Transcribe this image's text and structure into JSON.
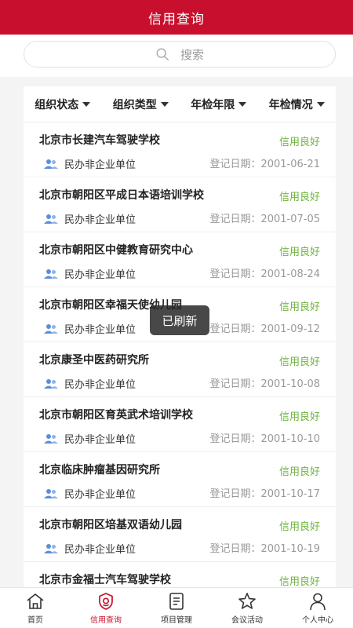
{
  "header": {
    "title": "信用查询"
  },
  "search": {
    "placeholder": "搜索"
  },
  "filters": [
    {
      "label": "组织状态"
    },
    {
      "label": "组织类型"
    },
    {
      "label": "年检年限"
    },
    {
      "label": "年检情况"
    }
  ],
  "items": [
    {
      "name": "北京市长建汽车驾驶学校",
      "status": "信用良好",
      "type": "民办非企业单位",
      "date": "登记日期：2001-06-21"
    },
    {
      "name": "北京市朝阳区平成日本语培训学校",
      "status": "信用良好",
      "type": "民办非企业单位",
      "date": "登记日期：2001-07-05"
    },
    {
      "name": "北京市朝阳区中健教育研究中心",
      "status": "信用良好",
      "type": "民办非企业单位",
      "date": "登记日期：2001-08-24"
    },
    {
      "name": "北京市朝阳区幸福天使幼儿园",
      "status": "信用良好",
      "type": "民办非企业单位",
      "date": "登记日期：2001-09-12"
    },
    {
      "name": "北京康圣中医药研究所",
      "status": "信用良好",
      "type": "民办非企业单位",
      "date": "登记日期：2001-10-08"
    },
    {
      "name": "北京市朝阳区育英武术培训学校",
      "status": "信用良好",
      "type": "民办非企业单位",
      "date": "登记日期：2001-10-10"
    },
    {
      "name": "北京临床肿瘤基因研究所",
      "status": "信用良好",
      "type": "民办非企业单位",
      "date": "登记日期：2001-10-17"
    },
    {
      "name": "北京市朝阳区培基双语幼儿园",
      "status": "信用良好",
      "type": "民办非企业单位",
      "date": "登记日期：2001-10-19"
    },
    {
      "name": "北京市金福士汽车驾驶学校",
      "status": "信用良好",
      "type": "",
      "date": ""
    }
  ],
  "toast": "已刷新",
  "tabs": [
    {
      "label": "首页",
      "icon": "home-icon"
    },
    {
      "label": "信用查询",
      "icon": "shield-icon"
    },
    {
      "label": "项目管理",
      "icon": "document-icon"
    },
    {
      "label": "会议活动",
      "icon": "star-icon"
    },
    {
      "label": "个人中心",
      "icon": "person-icon"
    }
  ],
  "colors": {
    "brand": "#c8102e",
    "status_good": "#6fb43f",
    "user_icon": "#5b8fd6"
  }
}
